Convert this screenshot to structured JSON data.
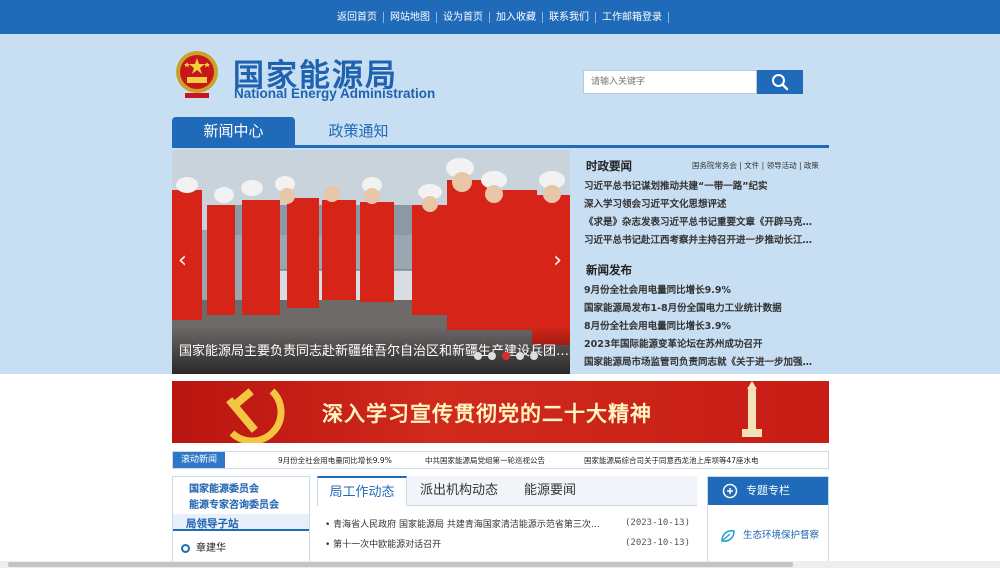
{
  "topnav": [
    "返回首页",
    "网站地图",
    "设为首页",
    "加入收藏",
    "联系我们",
    "工作邮箱登录"
  ],
  "logo": {
    "cn": "国家能源局",
    "en": "National Energy Administration"
  },
  "search": {
    "placeholder": "请输入关键字"
  },
  "tabs": [
    "新闻中心",
    "政策通知"
  ],
  "slider": {
    "caption": "国家能源局主要负责同志赴新疆维吾尔自治区和新疆生产建设兵团…",
    "dots": 5,
    "active_dot": 3
  },
  "politics": {
    "title": "时政要闻",
    "links": [
      "国务院常务会",
      "文件",
      "领导活动",
      "政策"
    ],
    "items": [
      "习近平总书记谋划推动共建“一带一路”纪实",
      "深入学习领会习近平文化思想评述",
      "《求是》杂志发表习近平总书记重要文章《开辟马克…",
      "习近平总书记赴江西考察并主持召开进一步推动长江…"
    ]
  },
  "news_release": {
    "title": "新闻发布",
    "items": [
      "9月份全社会用电量同比增长9.9%",
      "国家能源局发布1-8月份全国电力工业统计数据",
      "8月份全社会用电量同比增长3.9%",
      "2023年国际能源变革论坛在苏州成功召开",
      "国家能源局市场监管司负责同志就《关于进一步加强…"
    ]
  },
  "banner": {
    "text": "深入学习宣传贯彻党的二十大精神"
  },
  "rolling": {
    "label": "滚动新闻",
    "items": [
      "9月份全社会用电量同比增长9.9%",
      "中共国家能源局党组第一轮巡视公告",
      "国家能源局综合司关于同意西龙池上库坝等47座水电"
    ]
  },
  "leftnav": {
    "items": [
      "国家能源委员会",
      "能源专家咨询委员会"
    ],
    "guide_title": "局领导子站",
    "leader": "章建华"
  },
  "mid": {
    "tabs": [
      "局工作动态",
      "派出机构动态",
      "能源要闻"
    ],
    "rows": [
      {
        "text": "• 青海省人民政府 国家能源局 共建青海国家清洁能源示范省第三次…",
        "date": "(2023-10-13)"
      },
      {
        "text": "• 第十一次中欧能源对话召开",
        "date": "(2023-10-13)"
      }
    ]
  },
  "special": {
    "title": "专题专栏",
    "item": "生态环境保护督察"
  }
}
